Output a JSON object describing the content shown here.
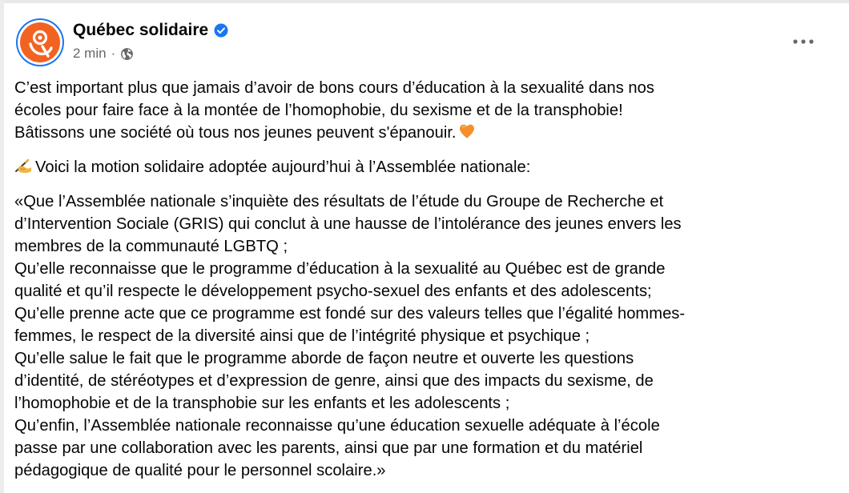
{
  "post": {
    "author": "Québec solidaire",
    "time": "2 min",
    "separator": "·",
    "paragraphs": [
      {
        "lines": [
          "C’est important plus que jamais d’avoir de bons cours d’éducation à la sexualité dans nos",
          "écoles pour faire face à la montée de l’homophobie, du sexisme et de la transphobie!",
          "Bâtissons une société où tous nos jeunes peuvent s'épanouir."
        ],
        "trailing_icon": "orange-heart-emoji"
      },
      {
        "leading_icon": "writing-hand-emoji",
        "lines": [
          "Voici la motion solidaire adoptée aujourd’hui à l’Assemblée nationale:"
        ]
      },
      {
        "lines": [
          "«Que l’Assemblée nationale s’inquiète des résultats de l’étude du Groupe de Recherche et",
          "d’Intervention Sociale (GRIS) qui conclut à une hausse de l’intolérance des jeunes envers les",
          "membres de la communauté LGBTQ ;",
          "Qu’elle reconnaisse que le programme d’éducation à la sexualité au Québec est de grande",
          "qualité et qu’il respecte le développement psycho-sexuel des enfants et des adolescents;",
          "Qu’elle prenne acte que ce programme est fondé sur des valeurs telles que l’égalité hommes-",
          "femmes, le respect de la diversité ainsi que de l’intégrité physique et psychique ;",
          "Qu’elle salue le fait que le programme aborde de façon neutre et ouverte les questions",
          "d’identité, de stéréotypes et d’expression de genre, ainsi que des impacts du sexisme, de",
          "l’homophobie et de la transphobie sur les enfants et les adolescents ;",
          "Qu’enfin, l’Assemblée nationale reconnaisse qu’une éducation sexuelle adéquate à l’école",
          "passe par une collaboration avec les parents, ainsi que par une formation et du matériel",
          "pédagogique de qualité pour le personnel scolaire.»"
        ]
      }
    ]
  },
  "icons": {
    "avatar": "quebec-solidaire-logo",
    "verified": "verified-badge-icon",
    "privacy": "globe-icon",
    "menu": "more-options-icon"
  },
  "colors": {
    "brand_orange": "#f26322",
    "verified_blue": "#1877f2",
    "text": "#050505",
    "secondary_text": "#65676b"
  }
}
